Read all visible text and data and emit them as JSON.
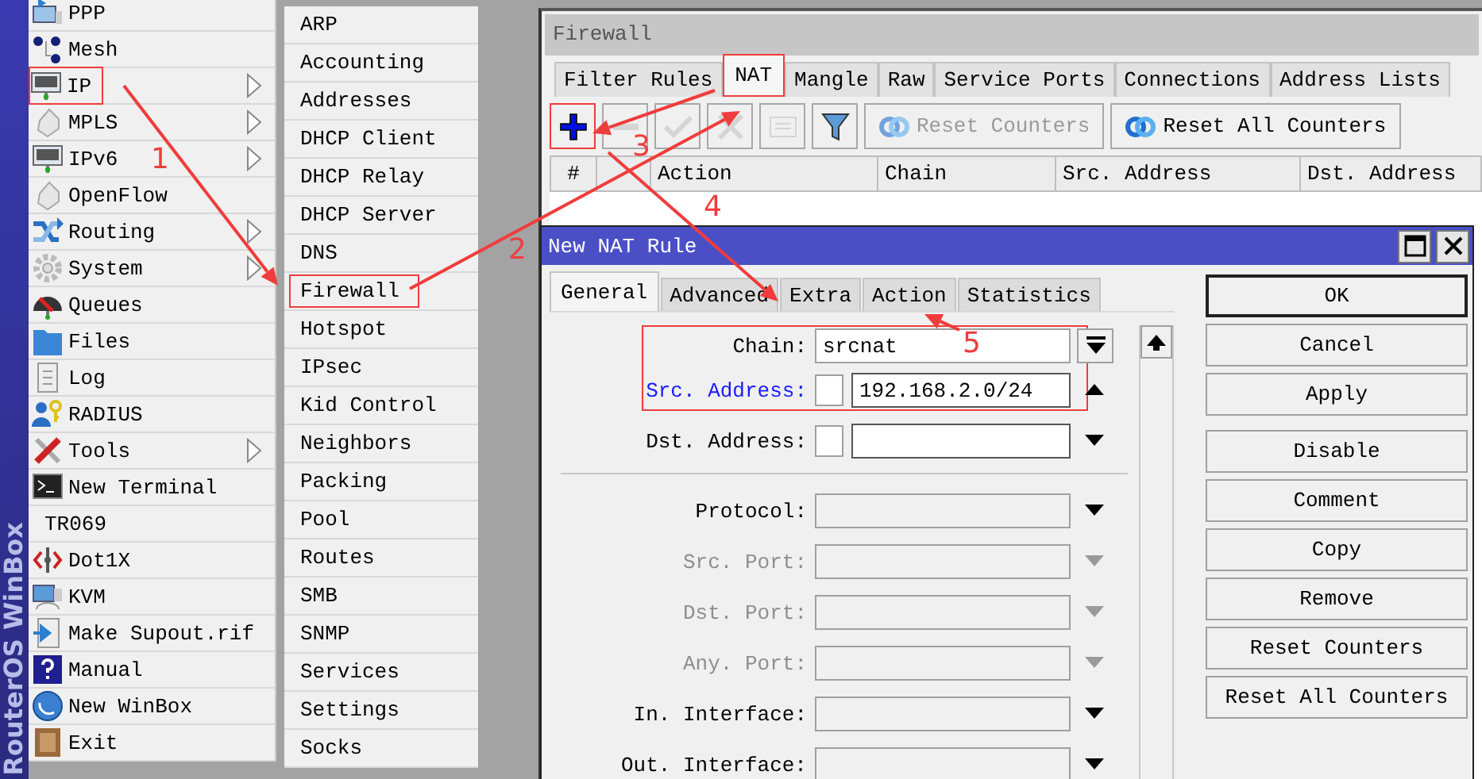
{
  "brand": "RouterOS WinBox",
  "main_menu": [
    {
      "label": "PPP",
      "submenu": false,
      "highlighted": false
    },
    {
      "label": "Mesh",
      "submenu": false,
      "highlighted": false
    },
    {
      "label": "IP",
      "submenu": true,
      "highlighted": true
    },
    {
      "label": "MPLS",
      "submenu": true,
      "highlighted": false
    },
    {
      "label": "IPv6",
      "submenu": true,
      "highlighted": false
    },
    {
      "label": "OpenFlow",
      "submenu": false,
      "highlighted": false
    },
    {
      "label": "Routing",
      "submenu": true,
      "highlighted": false
    },
    {
      "label": "System",
      "submenu": true,
      "highlighted": false
    },
    {
      "label": "Queues",
      "submenu": false,
      "highlighted": false
    },
    {
      "label": "Files",
      "submenu": false,
      "highlighted": false
    },
    {
      "label": "Log",
      "submenu": false,
      "highlighted": false
    },
    {
      "label": "RADIUS",
      "submenu": false,
      "highlighted": false
    },
    {
      "label": "Tools",
      "submenu": true,
      "highlighted": false
    },
    {
      "label": "New Terminal",
      "submenu": false,
      "highlighted": false
    },
    {
      "label": "TR069",
      "submenu": false,
      "highlighted": false
    },
    {
      "label": "Dot1X",
      "submenu": false,
      "highlighted": false
    },
    {
      "label": "KVM",
      "submenu": false,
      "highlighted": false
    },
    {
      "label": "Make Supout.rif",
      "submenu": false,
      "highlighted": false
    },
    {
      "label": "Manual",
      "submenu": false,
      "highlighted": false
    },
    {
      "label": "New WinBox",
      "submenu": false,
      "highlighted": false
    },
    {
      "label": "Exit",
      "submenu": false,
      "highlighted": false
    }
  ],
  "ip_submenu": [
    {
      "label": "ARP",
      "highlighted": false
    },
    {
      "label": "Accounting",
      "highlighted": false
    },
    {
      "label": "Addresses",
      "highlighted": false
    },
    {
      "label": "DHCP Client",
      "highlighted": false
    },
    {
      "label": "DHCP Relay",
      "highlighted": false
    },
    {
      "label": "DHCP Server",
      "highlighted": false
    },
    {
      "label": "DNS",
      "highlighted": false
    },
    {
      "label": "Firewall",
      "highlighted": true
    },
    {
      "label": "Hotspot",
      "highlighted": false
    },
    {
      "label": "IPsec",
      "highlighted": false
    },
    {
      "label": "Kid Control",
      "highlighted": false
    },
    {
      "label": "Neighbors",
      "highlighted": false
    },
    {
      "label": "Packing",
      "highlighted": false
    },
    {
      "label": "Pool",
      "highlighted": false
    },
    {
      "label": "Routes",
      "highlighted": false
    },
    {
      "label": "SMB",
      "highlighted": false
    },
    {
      "label": "SNMP",
      "highlighted": false
    },
    {
      "label": "Services",
      "highlighted": false
    },
    {
      "label": "Settings",
      "highlighted": false
    },
    {
      "label": "Socks",
      "highlighted": false
    }
  ],
  "firewall_window": {
    "title": "Firewall",
    "tabs": [
      {
        "label": "Filter Rules",
        "selected": false,
        "highlighted": false
      },
      {
        "label": "NAT",
        "selected": true,
        "highlighted": true
      },
      {
        "label": "Mangle",
        "selected": false,
        "highlighted": false
      },
      {
        "label": "Raw",
        "selected": false,
        "highlighted": false
      },
      {
        "label": "Service Ports",
        "selected": false,
        "highlighted": false
      },
      {
        "label": "Connections",
        "selected": false,
        "highlighted": false
      },
      {
        "label": "Address Lists",
        "selected": false,
        "highlighted": false
      }
    ],
    "toolbar": [
      {
        "kind": "add",
        "disabled": false,
        "highlighted": true
      },
      {
        "kind": "remove",
        "disabled": true,
        "highlighted": false
      },
      {
        "kind": "enable",
        "disabled": true,
        "highlighted": false
      },
      {
        "kind": "disable",
        "disabled": true,
        "highlighted": false
      },
      {
        "kind": "comment",
        "disabled": true,
        "highlighted": false
      },
      {
        "kind": "filter",
        "disabled": false,
        "highlighted": false
      },
      {
        "kind": "reset",
        "label": "Reset Counters",
        "disabled": true,
        "highlighted": false
      },
      {
        "kind": "reset",
        "label": "Reset All Counters",
        "disabled": false,
        "highlighted": false
      }
    ],
    "columns": [
      "#",
      "Action",
      "Chain",
      "Src. Address",
      "Dst. Address"
    ]
  },
  "nat_rule_dialog": {
    "title": "New NAT Rule",
    "tabs": [
      {
        "label": "General",
        "selected": true
      },
      {
        "label": "Advanced",
        "selected": false
      },
      {
        "label": "Extra",
        "selected": false
      },
      {
        "label": "Action",
        "selected": false
      },
      {
        "label": "Statistics",
        "selected": false
      }
    ],
    "fields": [
      {
        "kind": "combo",
        "label": "Chain:",
        "value": "srcnat",
        "disabled": false,
        "active": false,
        "highlighted": true
      },
      {
        "kind": "address",
        "label": "Src. Address:",
        "value": "192.168.2.0/24",
        "inverted": false,
        "disabled": false,
        "active": true,
        "expanded": true,
        "highlighted": true
      },
      {
        "kind": "address",
        "label": "Dst. Address:",
        "inverted": false,
        "disabled": false,
        "active": false,
        "expanded": false,
        "highlighted": false
      },
      {
        "kind": "separator"
      },
      {
        "kind": "select",
        "label": "Protocol:",
        "disabled": false,
        "active": false,
        "expanded": false,
        "highlighted": false
      },
      {
        "kind": "select",
        "label": "Src. Port:",
        "disabled": true,
        "active": false,
        "expanded": false,
        "highlighted": false
      },
      {
        "kind": "select",
        "label": "Dst. Port:",
        "disabled": true,
        "active": false,
        "expanded": false,
        "highlighted": false
      },
      {
        "kind": "select",
        "label": "Any. Port:",
        "disabled": true,
        "active": false,
        "expanded": false,
        "highlighted": false
      },
      {
        "kind": "select",
        "label": "In. Interface:",
        "disabled": false,
        "active": false,
        "expanded": false,
        "highlighted": false
      },
      {
        "kind": "select",
        "label": "Out. Interface:",
        "disabled": false,
        "active": false,
        "expanded": false,
        "highlighted": false
      }
    ],
    "button_groups": [
      [
        {
          "label": "OK",
          "default": true
        },
        {
          "label": "Cancel",
          "default": false
        },
        {
          "label": "Apply",
          "default": false
        }
      ],
      [
        {
          "label": "Disable",
          "default": false
        },
        {
          "label": "Comment",
          "default": false
        },
        {
          "label": "Copy",
          "default": false
        },
        {
          "label": "Remove",
          "default": false
        },
        {
          "label": "Reset Counters",
          "default": false
        },
        {
          "label": "Reset All Counters",
          "default": false
        }
      ]
    ]
  },
  "annotations": [
    {
      "label": "1"
    },
    {
      "label": "2"
    },
    {
      "label": "3"
    },
    {
      "label": "4"
    },
    {
      "label": "5"
    }
  ]
}
